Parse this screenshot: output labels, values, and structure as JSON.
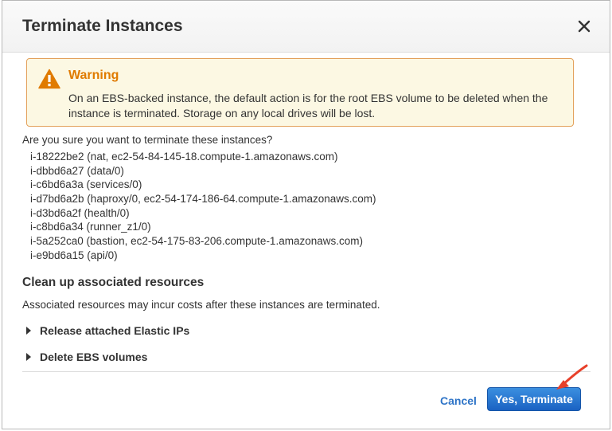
{
  "dialog": {
    "title": "Terminate Instances",
    "close_icon": "close-icon"
  },
  "warning": {
    "icon": "warning-icon",
    "title": "Warning",
    "text": "On an EBS-backed instance, the default action is for the root EBS volume to be deleted when the instance is terminated. Storage on any local drives will be lost."
  },
  "question": "Are you sure you want to terminate these instances?",
  "instances": [
    "i-18222be2 (nat, ec2-54-84-145-18.compute-1.amazonaws.com)",
    "i-dbbd6a27 (data/0)",
    "i-c6bd6a3a (services/0)",
    "i-d7bd6a2b (haproxy/0, ec2-54-174-186-64.compute-1.amazonaws.com)",
    "i-d3bd6a2f (health/0)",
    "i-c8bd6a34 (runner_z1/0)",
    "i-5a252ca0 (bastion, ec2-54-175-83-206.compute-1.amazonaws.com)",
    "i-e9bd6a15 (api/0)"
  ],
  "cleanup": {
    "title": "Clean up associated resources",
    "description": "Associated resources may incur costs after these instances are terminated.",
    "options": [
      {
        "label": "Release attached Elastic IPs",
        "icon": "caret-right-icon"
      },
      {
        "label": "Delete EBS volumes",
        "icon": "caret-right-icon"
      }
    ]
  },
  "footer": {
    "cancel_label": "Cancel",
    "confirm_label": "Yes, Terminate"
  },
  "colors": {
    "warning_title": "#e07b00",
    "warning_bg": "#fcf8e3",
    "warning_border": "#e3a05a",
    "link": "#2e74c7",
    "primary": "#1a62c2",
    "annotation_arrow": "#e8402a"
  }
}
